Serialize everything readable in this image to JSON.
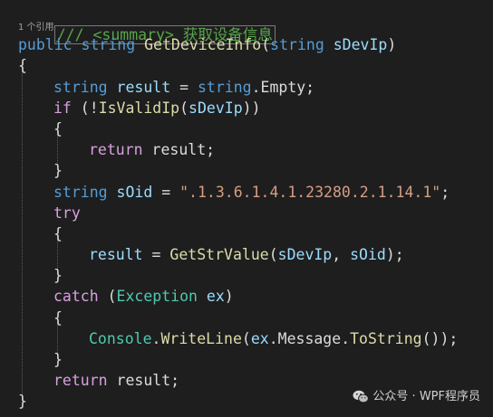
{
  "editor": {
    "summary_comment": "/// <summary> 获取设备信息",
    "codelens_references": "1 个引用",
    "signature": {
      "modifier": "public",
      "return_type": "string",
      "method_name": "GetDeviceInfo",
      "open_paren": "(",
      "param_type": "string",
      "param_name": "sDevIp",
      "close_paren": ")"
    },
    "brace_open": "{",
    "brace_close": "}",
    "line_result_decl": {
      "type": "string",
      "name": "result",
      "assign": " = ",
      "rhs_type": "string",
      "rhs_member": ".Empty;"
    },
    "line_if": {
      "keyword": "if",
      "pre": " (!",
      "method": "IsValidIp",
      "open": "(",
      "arg": "sDevIp",
      "post": "))"
    },
    "line_return1": {
      "keyword": "return",
      "value": " result;"
    },
    "line_oid": {
      "type": "string",
      "name": "sOid",
      "assign": " = ",
      "string_value": "\".1.3.6.1.4.1.23280.2.1.14.1\"",
      "end": ";"
    },
    "line_try": "try",
    "line_getstr": {
      "target": "result",
      "assign": " = ",
      "method": "GetStrValue",
      "open": "(",
      "arg1": "sDevIp",
      "sep": ", ",
      "arg2": "sOid",
      "close": ");"
    },
    "line_catch": {
      "keyword": "catch",
      "open": " (",
      "type": "Exception",
      "var": " ex",
      "close": ")"
    },
    "line_console": {
      "class": "Console",
      "dot1": ".",
      "method": "WriteLine",
      "open": "(",
      "obj": "ex",
      "dot2": ".",
      "prop": "Message",
      "dot3": ".",
      "method2": "ToString",
      "close": "());"
    },
    "line_return2": {
      "keyword": "return",
      "value": " result;"
    }
  },
  "watermark": {
    "text": "公众号 · WPF程序员",
    "icon": "wechat-icon"
  },
  "colors": {
    "background": "#1e1e1e",
    "keyword": "#569cd6",
    "control": "#d8a0df",
    "type": "#4ec9b0",
    "method": "#dcdcaa",
    "identifier": "#9cdcfe",
    "string": "#d69d85",
    "comment": "#57a64a"
  }
}
